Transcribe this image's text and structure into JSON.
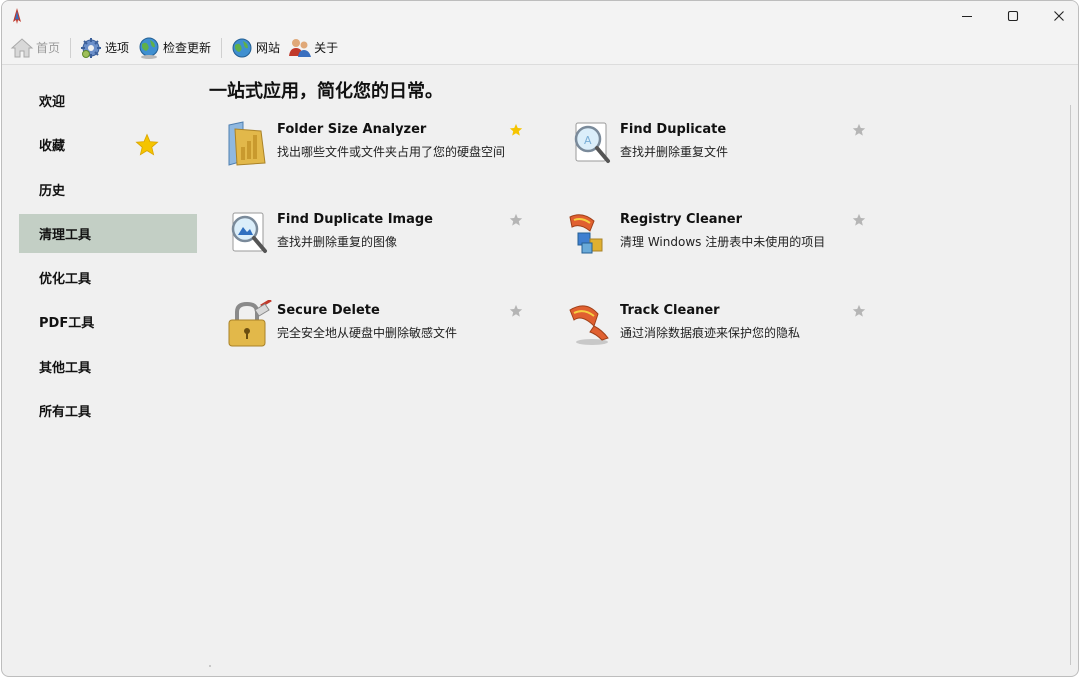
{
  "window": {
    "title": ""
  },
  "toolbar": {
    "home_label": "首页",
    "options_label": "选项",
    "update_label": "检查更新",
    "website_label": "网站",
    "about_label": "关于"
  },
  "sidebar": {
    "items": [
      {
        "label": "欢迎"
      },
      {
        "label": "收藏"
      },
      {
        "label": "历史"
      },
      {
        "label": "清理工具",
        "selected": true
      },
      {
        "label": "优化工具"
      },
      {
        "label": "PDF工具"
      },
      {
        "label": "其他工具"
      },
      {
        "label": "所有工具"
      }
    ]
  },
  "main": {
    "heading": "一站式应用，简化您的日常。",
    "tools": [
      {
        "name": "Folder Size Analyzer",
        "desc": "找出哪些文件或文件夹占用了您的硬盘空间",
        "favorite": true,
        "icon": "folder-size-icon"
      },
      {
        "name": "Find Duplicate",
        "desc": "查找并删除重复文件",
        "favorite": false,
        "icon": "find-duplicate-icon"
      },
      {
        "name": "Find Duplicate Image",
        "desc": "查找并删除重复的图像",
        "favorite": false,
        "icon": "find-duplicate-image-icon"
      },
      {
        "name": "Registry Cleaner",
        "desc": "清理 Windows 注册表中未使用的项目",
        "favorite": false,
        "icon": "registry-cleaner-icon"
      },
      {
        "name": "Secure Delete",
        "desc": "完全安全地从硬盘中删除敏感文件",
        "favorite": false,
        "icon": "secure-delete-icon"
      },
      {
        "name": "Track Cleaner",
        "desc": "通过消除数据痕迹来保护您的隐私",
        "favorite": false,
        "icon": "track-cleaner-icon"
      }
    ]
  },
  "colors": {
    "selected_bg": "#c3cfc5",
    "favorite_star": "#f5c400",
    "inactive_star": "#b5b5b5"
  }
}
